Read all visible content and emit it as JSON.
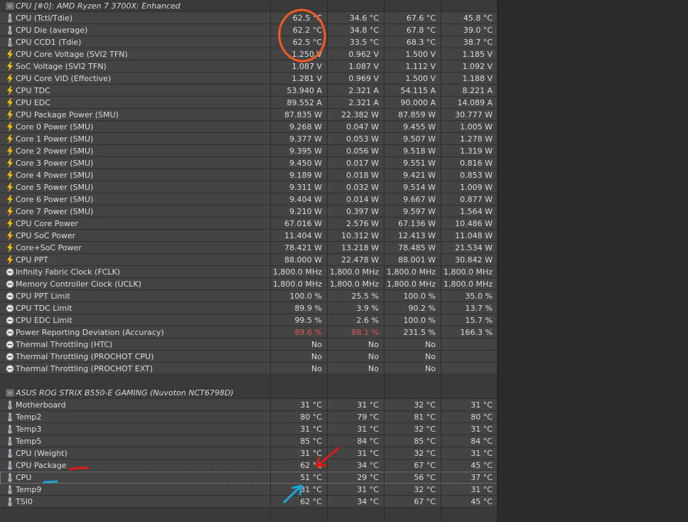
{
  "sections": [
    {
      "title": "CPU [#0]: AMD Ryzen 7 3700X: Enhanced",
      "rows": [
        {
          "icon": "thermometer-icon",
          "label": "CPU (Tctl/Tdie)",
          "values": [
            "62.5 °C",
            "34.6 °C",
            "67.6 °C",
            "45.8 °C"
          ]
        },
        {
          "icon": "thermometer-icon",
          "label": "CPU Die (average)",
          "values": [
            "62.2 °C",
            "34.8 °C",
            "67.8 °C",
            "39.0 °C"
          ]
        },
        {
          "icon": "thermometer-icon",
          "label": "CPU CCD1 (Tdie)",
          "values": [
            "62.5 °C",
            "33.5 °C",
            "68.3 °C",
            "38.7 °C"
          ]
        },
        {
          "icon": "lightning-icon",
          "label": "CPU Core Voltage (SVI2 TFN)",
          "values": [
            "1.250 V",
            "0.962 V",
            "1.500 V",
            "1.185 V"
          ]
        },
        {
          "icon": "lightning-icon",
          "label": "SoC Voltage (SVI2 TFN)",
          "values": [
            "1.087 V",
            "1.087 V",
            "1.112 V",
            "1.092 V"
          ]
        },
        {
          "icon": "lightning-icon",
          "label": "CPU Core VID (Effective)",
          "values": [
            "1.281 V",
            "0.969 V",
            "1.500 V",
            "1.188 V"
          ]
        },
        {
          "icon": "lightning-icon",
          "label": "CPU TDC",
          "values": [
            "53.940 A",
            "2.321 A",
            "54.115 A",
            "8.221 A"
          ]
        },
        {
          "icon": "lightning-icon",
          "label": "CPU EDC",
          "values": [
            "89.552 A",
            "2.321 A",
            "90.000 A",
            "14.089 A"
          ]
        },
        {
          "icon": "lightning-icon",
          "label": "CPU Package Power (SMU)",
          "values": [
            "87.835 W",
            "22.382 W",
            "87.859 W",
            "30.777 W"
          ]
        },
        {
          "icon": "lightning-icon",
          "label": "Core 0 Power (SMU)",
          "values": [
            "9.268 W",
            "0.047 W",
            "9.455 W",
            "1.005 W"
          ]
        },
        {
          "icon": "lightning-icon",
          "label": "Core 1 Power (SMU)",
          "values": [
            "9.377 W",
            "0.053 W",
            "9.507 W",
            "1.278 W"
          ]
        },
        {
          "icon": "lightning-icon",
          "label": "Core 2 Power (SMU)",
          "values": [
            "9.395 W",
            "0.056 W",
            "9.518 W",
            "1.319 W"
          ]
        },
        {
          "icon": "lightning-icon",
          "label": "Core 3 Power (SMU)",
          "values": [
            "9.450 W",
            "0.017 W",
            "9.551 W",
            "0.816 W"
          ]
        },
        {
          "icon": "lightning-icon",
          "label": "Core 4 Power (SMU)",
          "values": [
            "9.189 W",
            "0.018 W",
            "9.421 W",
            "0.853 W"
          ]
        },
        {
          "icon": "lightning-icon",
          "label": "Core 5 Power (SMU)",
          "values": [
            "9.311 W",
            "0.032 W",
            "9.514 W",
            "1.009 W"
          ]
        },
        {
          "icon": "lightning-icon",
          "label": "Core 6 Power (SMU)",
          "values": [
            "9.404 W",
            "0.014 W",
            "9.667 W",
            "0.877 W"
          ]
        },
        {
          "icon": "lightning-icon",
          "label": "Core 7 Power (SMU)",
          "values": [
            "9.210 W",
            "0.397 W",
            "9.597 W",
            "1.564 W"
          ]
        },
        {
          "icon": "lightning-icon",
          "label": "CPU Core Power",
          "values": [
            "67.016 W",
            "2.576 W",
            "67.136 W",
            "10.486 W"
          ]
        },
        {
          "icon": "lightning-icon",
          "label": "CPU SoC Power",
          "values": [
            "11.404 W",
            "10.312 W",
            "12.413 W",
            "11.048 W"
          ]
        },
        {
          "icon": "lightning-icon",
          "label": "Core+SoC Power",
          "values": [
            "78.421 W",
            "13.218 W",
            "78.485 W",
            "21.534 W"
          ]
        },
        {
          "icon": "lightning-icon",
          "label": "CPU PPT",
          "values": [
            "88.000 W",
            "22.478 W",
            "88.001 W",
            "30.842 W"
          ]
        },
        {
          "icon": "clock-icon",
          "label": "Infinity Fabric Clock (FCLK)",
          "values": [
            "1,800.0 MHz",
            "1,800.0 MHz",
            "1,800.0 MHz",
            "1,800.0 MHz"
          ]
        },
        {
          "icon": "clock-icon",
          "label": "Memory Controller Clock (UCLK)",
          "values": [
            "1,800.0 MHz",
            "1,800.0 MHz",
            "1,800.0 MHz",
            "1,800.0 MHz"
          ]
        },
        {
          "icon": "clock-icon",
          "label": "CPU PPT Limit",
          "values": [
            "100.0 %",
            "25.5 %",
            "100.0 %",
            "35.0 %"
          ]
        },
        {
          "icon": "clock-icon",
          "label": "CPU TDC Limit",
          "values": [
            "89.9 %",
            "3.9 %",
            "90.2 %",
            "13.7 %"
          ]
        },
        {
          "icon": "clock-icon",
          "label": "CPU EDC Limit",
          "values": [
            "99.5 %",
            "2.6 %",
            "100.0 %",
            "15.7 %"
          ]
        },
        {
          "icon": "clock-icon",
          "label": "Power Reporting Deviation (Accuracy)",
          "values": [
            "89.6 %",
            "88.1 %",
            "231.5 %",
            "166.3 %"
          ],
          "red": [
            true,
            true,
            false,
            false
          ]
        },
        {
          "icon": "clock-icon",
          "label": "Thermal Throttling (HTC)",
          "values": [
            "No",
            "No",
            "No",
            ""
          ]
        },
        {
          "icon": "clock-icon",
          "label": "Thermal Throttling (PROCHOT CPU)",
          "values": [
            "No",
            "No",
            "No",
            ""
          ]
        },
        {
          "icon": "clock-icon",
          "label": "Thermal Throttling (PROCHOT EXT)",
          "values": [
            "No",
            "No",
            "No",
            ""
          ]
        }
      ]
    },
    {
      "title": "ASUS ROG STRIX B550-E GAMING (Nuvoton NCT6798D)",
      "rows": [
        {
          "icon": "thermometer-icon",
          "label": "Motherboard",
          "values": [
            "31 °C",
            "31 °C",
            "32 °C",
            "31 °C"
          ]
        },
        {
          "icon": "thermometer-icon",
          "label": "Temp2",
          "values": [
            "80 °C",
            "79 °C",
            "81 °C",
            "80 °C"
          ]
        },
        {
          "icon": "thermometer-icon",
          "label": "Temp3",
          "values": [
            "31 °C",
            "31 °C",
            "32 °C",
            "31 °C"
          ]
        },
        {
          "icon": "thermometer-icon",
          "label": "Temp5",
          "values": [
            "85 °C",
            "84 °C",
            "85 °C",
            "84 °C"
          ]
        },
        {
          "icon": "thermometer-icon",
          "label": "CPU (Weight)",
          "values": [
            "31 °C",
            "31 °C",
            "32 °C",
            "31 °C"
          ]
        },
        {
          "icon": "thermometer-icon",
          "label": "CPU Package",
          "values": [
            "62 °C",
            "34 °C",
            "67 °C",
            "45 °C"
          ]
        },
        {
          "icon": "thermometer-icon",
          "label": "CPU",
          "values": [
            "51 °C",
            "29 °C",
            "56 °C",
            "37 °C"
          ],
          "selected": true
        },
        {
          "icon": "thermometer-icon",
          "label": "Temp9",
          "values": [
            "31 °C",
            "31 °C",
            "32 °C",
            "31 °C"
          ]
        },
        {
          "icon": "thermometer-icon",
          "label": "TSI0",
          "values": [
            "62 °C",
            "34 °C",
            "67 °C",
            "45 °C"
          ]
        }
      ]
    }
  ],
  "colors": {
    "row_bg": "#444444",
    "header_bg": "#3a3a3a",
    "text": "#dcdcdc",
    "warning_red": "#e05555",
    "annotation_orange": "#ff5a1e",
    "annotation_red": "#e01818",
    "annotation_cyan": "#1aa6d6"
  }
}
